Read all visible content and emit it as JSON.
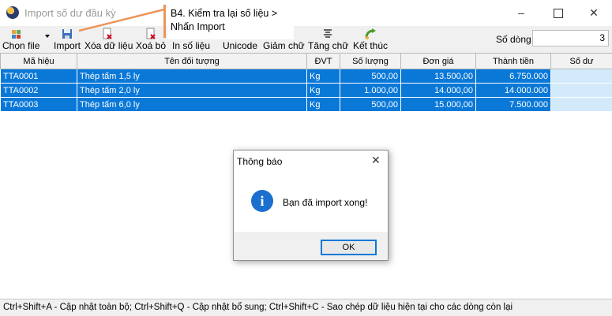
{
  "window": {
    "title": "Import số dư đầu kỳ",
    "minimize": "–",
    "close": "✕"
  },
  "callout": {
    "line1": "B4. Kiểm tra lại số liệu >",
    "line2": "Nhấn Import",
    "color": "#e9965a"
  },
  "toolbar": {
    "items": [
      {
        "label": "Chọn file",
        "icon": "file-select-icon"
      },
      {
        "label": "Import",
        "icon": "save-icon"
      },
      {
        "label": "Xóa dữ liệu",
        "icon": "delete-data-icon"
      },
      {
        "label": "Xoá bỏ",
        "icon": "delete-icon"
      },
      {
        "label": "In số liệu"
      },
      {
        "label": "Unicode"
      },
      {
        "label": "Giảm chữ"
      },
      {
        "label": "Tăng chữ",
        "icon": "increase-font-icon"
      },
      {
        "label": "Kết thúc",
        "icon": "exit-icon"
      }
    ],
    "rows_label": "Số dòng",
    "rows_value": "3"
  },
  "grid": {
    "columns": [
      "Mã hiệu",
      "Tên đối tượng",
      "ĐVT",
      "Số lượng",
      "Đơn giá",
      "Thành tiền",
      "Số dư"
    ],
    "rows": [
      [
        "TTA0001",
        "Thép tấm 1,5 ly",
        "Kg",
        "500,00",
        "13.500,00",
        "6.750.000",
        ""
      ],
      [
        "TTA0002",
        "Thép tấm 2,0 ly",
        "Kg",
        "1.000,00",
        "14.000,00",
        "14.000.000",
        ""
      ],
      [
        "TTA0003",
        "Thép tấm 6,0 ly",
        "Kg",
        "500,00",
        "15.000,00",
        "7.500.000",
        ""
      ]
    ],
    "selection_color": "#0a78d7"
  },
  "dialog": {
    "title": "Thông báo",
    "close": "✕",
    "icon": "info-icon",
    "message": "Bạn đã import xong!",
    "ok": "OK"
  },
  "status": {
    "text": "Ctrl+Shift+A - Cập nhật toàn bộ; Ctrl+Shift+Q - Cập nhật bổ sung; Ctrl+Shift+C - Sao chép dữ liệu hiện tại cho các dòng còn lại"
  }
}
